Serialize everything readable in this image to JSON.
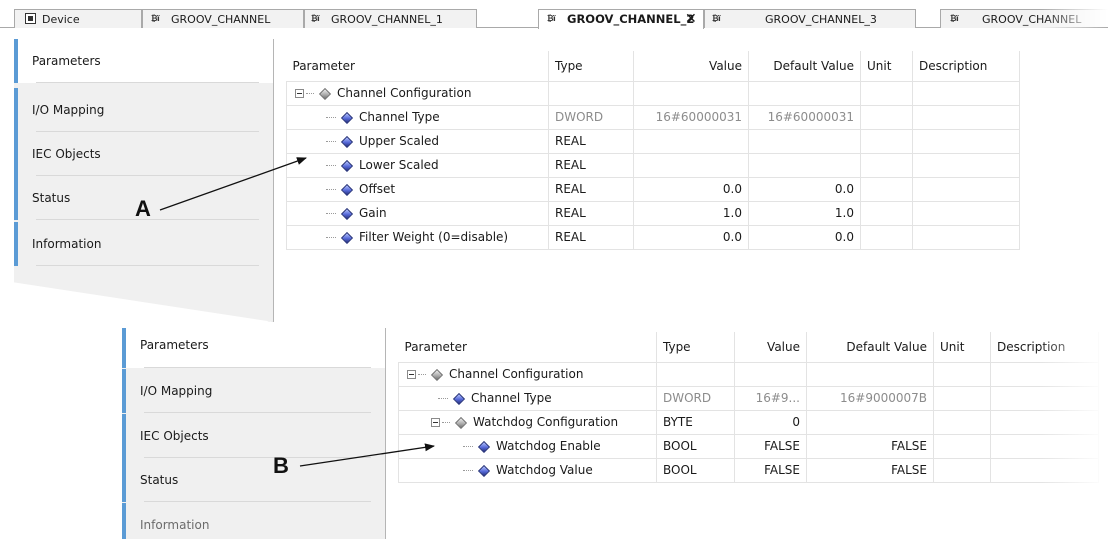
{
  "tabs": [
    {
      "label": "Device",
      "icon": "device-icon",
      "active": false
    },
    {
      "label": "GROOV_CHANNEL",
      "icon": "io-channel-icon",
      "active": false
    },
    {
      "label": "GROOV_CHANNEL_1",
      "icon": "io-channel-icon",
      "active": false
    },
    {
      "label": "GROOV_CHANNEL_2",
      "icon": "io-channel-icon",
      "active": true,
      "close": "✕"
    },
    {
      "label": "GROOV_CHANNEL_3",
      "icon": "io-channel-icon",
      "active": false
    },
    {
      "label": "GROOV_CHANNEL",
      "icon": "io-channel-icon",
      "active": false
    }
  ],
  "tab_icon_text": "₿ï",
  "annotations": {
    "a": "A",
    "b": "B"
  },
  "panel_a": {
    "sidebar": [
      "Parameters",
      "I/O Mapping",
      "IEC Objects",
      "Status",
      "Information"
    ],
    "columns": {
      "parameter": "Parameter",
      "type": "Type",
      "value": "Value",
      "default": "Default Value",
      "unit": "Unit",
      "description": "Description"
    },
    "rows": [
      {
        "name": "Channel Configuration",
        "type": "",
        "value": "",
        "default": "",
        "unit": "",
        "description": ""
      },
      {
        "name": "Channel Type",
        "type": "DWORD",
        "value": "16#60000031",
        "default": "16#60000031",
        "unit": "",
        "description": ""
      },
      {
        "name": "Upper Scaled",
        "type": "REAL",
        "value": "",
        "default": "",
        "unit": "",
        "description": ""
      },
      {
        "name": "Lower Scaled",
        "type": "REAL",
        "value": "",
        "default": "",
        "unit": "",
        "description": ""
      },
      {
        "name": "Offset",
        "type": "REAL",
        "value": "0.0",
        "default": "0.0",
        "unit": "",
        "description": ""
      },
      {
        "name": "Gain",
        "type": "REAL",
        "value": "1.0",
        "default": "1.0",
        "unit": "",
        "description": ""
      },
      {
        "name": "Filter Weight (0=disable)",
        "type": "REAL",
        "value": "0.0",
        "default": "0.0",
        "unit": "",
        "description": ""
      }
    ]
  },
  "panel_b": {
    "sidebar": [
      "Parameters",
      "I/O Mapping",
      "IEC Objects",
      "Status",
      "Information"
    ],
    "columns": {
      "parameter": "Parameter",
      "type": "Type",
      "value": "Value",
      "default": "Default Value",
      "unit": "Unit",
      "description": "Description"
    },
    "rows": [
      {
        "name": "Channel Configuration",
        "type": "",
        "value": "",
        "default": "",
        "unit": "",
        "description": ""
      },
      {
        "name": "Channel Type",
        "type": "DWORD",
        "value": "16#9...",
        "default": "16#9000007B",
        "unit": "",
        "description": ""
      },
      {
        "name": "Watchdog Configuration",
        "type": "BYTE",
        "value": "0",
        "default": "",
        "unit": "",
        "description": ""
      },
      {
        "name": "Watchdog Enable",
        "type": "BOOL",
        "value": "FALSE",
        "default": "FALSE",
        "unit": "",
        "description": ""
      },
      {
        "name": "Watchdog Value",
        "type": "BOOL",
        "value": "FALSE",
        "default": "FALSE",
        "unit": "",
        "description": ""
      }
    ]
  },
  "colors": {
    "accent": "#5b9bd5",
    "sidebar_bg": "#f0f0f0",
    "dim_text": "#8c8c8c"
  }
}
